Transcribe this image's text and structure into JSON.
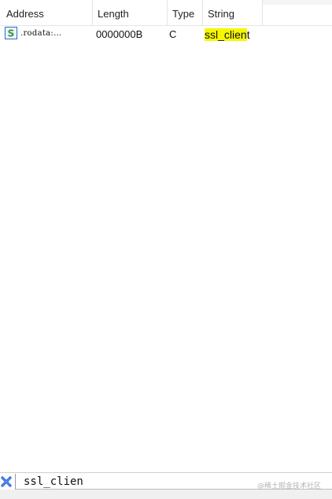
{
  "columns": {
    "address": "Address",
    "length": "Length",
    "type": "Type",
    "string": "String"
  },
  "rows": [
    {
      "icon": "string-s-icon",
      "address": ".rodata:…",
      "length": "0000000B",
      "type": "C",
      "string_match": "ssl_clien",
      "string_rest": "t"
    }
  ],
  "search": {
    "value": "ssl_clien"
  },
  "watermark": "@稀土掘金技术社区",
  "colors": {
    "highlight": "#f6f600",
    "icon_green": "#2f9a3a",
    "icon_blue": "#2b63c6",
    "close_blue": "#1f5fd0"
  }
}
